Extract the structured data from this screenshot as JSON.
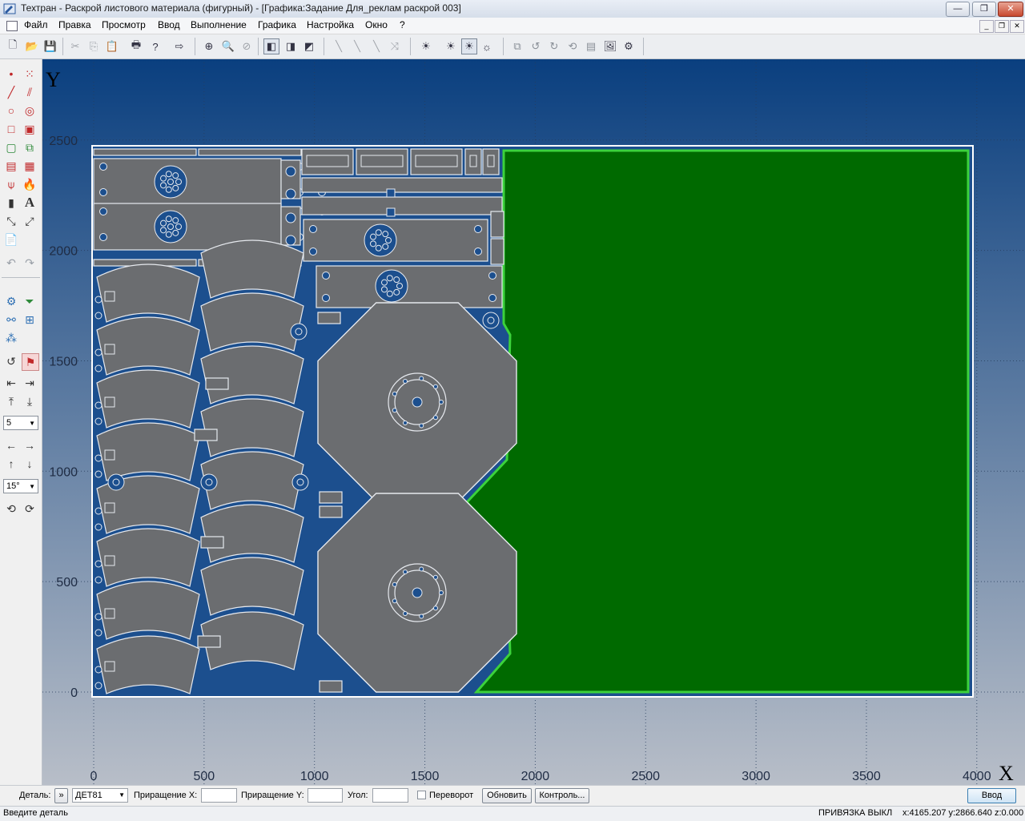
{
  "window": {
    "title": "Техтран - Раскрой листового материала (фигурный) - [Графика:Задание Для_реклам раскрой 003]",
    "min_symbol": "—",
    "max_symbol": "❐",
    "close_symbol": "✕"
  },
  "menu": {
    "items": [
      "Файл",
      "Правка",
      "Просмотр",
      "Ввод",
      "Выполнение",
      "Графика",
      "Настройка",
      "Окно",
      "?"
    ]
  },
  "toolbar": {
    "icons": [
      "new-file-icon",
      "open-folder-icon",
      "save-icon",
      "cut-icon",
      "copy-icon",
      "paste-icon",
      "print-icon",
      "help-icon",
      "export-icon",
      "zoom-in-icon",
      "zoom-window-icon",
      "zoom-all-icon",
      "view-iso-1-icon",
      "view-iso-2-icon",
      "view-iso-3-icon",
      "line-tool-1-icon",
      "line-tool-2-icon",
      "line-tool-3-icon",
      "line-tool-4-icon",
      "light-1-icon",
      "light-2-icon",
      "light-3-icon",
      "light-4-icon",
      "part-1-icon",
      "part-2-icon",
      "part-3-icon",
      "part-4-icon",
      "part-5-icon",
      "part-6-icon",
      "part-7-icon"
    ]
  },
  "left_panel": {
    "step_value": "5",
    "angle_value": "15°",
    "text_tool": "A"
  },
  "canvas": {
    "axis_y_name": "Y",
    "axis_x_name": "X",
    "y_ticks": [
      "2500",
      "2000",
      "1500",
      "1000",
      "500",
      "0"
    ],
    "x_ticks": [
      "0",
      "500",
      "1000",
      "1500",
      "2000",
      "2500",
      "3000",
      "3500",
      "4000"
    ],
    "colors": {
      "background_top": "#0a3f7f",
      "background_bottom": "#b8bec8",
      "sheet_border": "#ffffff",
      "part_fill": "#6b6d70",
      "part_stroke": "#e6e9ee",
      "remnant_fill": "#006a00",
      "remnant_stroke": "#3cd23c",
      "gap_fill": "#1c4f8e"
    }
  },
  "input_bar": {
    "detail_label": "Деталь:",
    "detail_arrow": "»",
    "detail_value": "ДЕТ81",
    "dx_label": "Приращение X:",
    "dx_value": "",
    "dy_label": "Приращение Y:",
    "dy_value": "",
    "angle_label": "Угол:",
    "angle_value": "",
    "flip_label": "Переворот",
    "update_button": "Обновить",
    "control_button": "Контроль...",
    "enter_button": "Ввод"
  },
  "status": {
    "prompt": "Введите деталь",
    "snap": "ПРИВЯЗКА ВЫКЛ",
    "coords": "x:4165.207 y:2866.640 z:0.000"
  }
}
